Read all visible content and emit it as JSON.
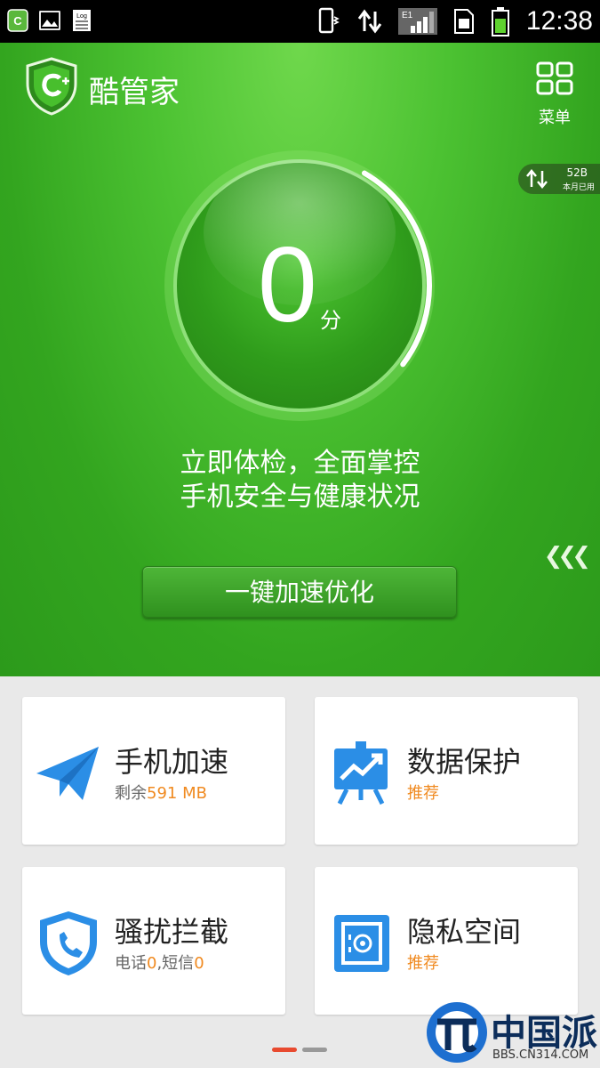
{
  "status_bar": {
    "time": "12:38",
    "log_label": "Log",
    "network": "E1"
  },
  "header": {
    "app_title": "酷管家",
    "menu_label": "菜单",
    "traffic_value": "52B",
    "traffic_caption": "本月已用",
    "score_value": "0",
    "score_unit": "分",
    "score_progress": 0.27,
    "tagline_line1": "立即体检，全面掌控",
    "tagline_line2": "手机安全与健康状况",
    "boost_button": "一键加速优化"
  },
  "cards": [
    {
      "title": "手机加速",
      "sub_prefix": "剩余",
      "sub_value": "591 MB",
      "sub_suffix": "",
      "icon": "paper-plane-icon"
    },
    {
      "title": "数据保护",
      "sub_prefix": "",
      "sub_value": "推荐",
      "sub_suffix": "",
      "icon": "chart-board-icon"
    },
    {
      "title": "骚扰拦截",
      "sub_prefix": "电话",
      "sub_value": "0",
      "sub_mid": ",短信",
      "sub_value2": "0",
      "icon": "phone-shield-icon"
    },
    {
      "title": "隐私空间",
      "sub_prefix": "",
      "sub_value": "推荐",
      "sub_suffix": "",
      "icon": "safe-icon"
    }
  ],
  "page_indicator": {
    "pages": 2,
    "active": 0
  },
  "watermark": {
    "text": "中国派",
    "url": "BBS.CN314.COM"
  },
  "colors": {
    "green": "#4cc232",
    "orange": "#f08a20",
    "blue": "#2b8ee6",
    "indicator_active": "#e84a2f"
  }
}
